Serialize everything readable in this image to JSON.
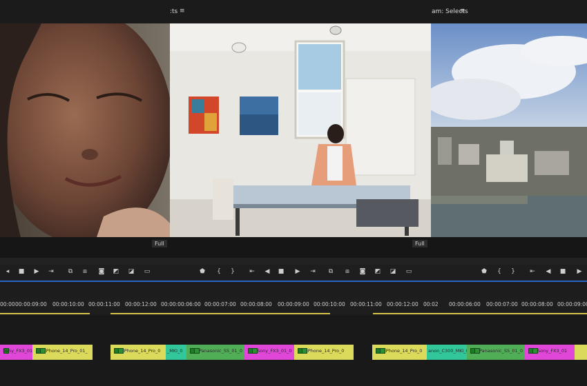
{
  "top": {
    "middle_title": ":ts",
    "right_title": "am: Selects",
    "menu_glyph": "≡"
  },
  "monitors": {
    "left_label": "Full",
    "right_label": "Full"
  },
  "left_transport": [
    "marker-icon",
    "go-in-icon",
    "step-back-icon",
    "play-icon",
    "step-forward-icon",
    "go-out-icon",
    "insert-icon",
    "overwrite-icon",
    "export-frame-icon",
    "lift-icon",
    "extract-icon",
    "settings-icon"
  ],
  "right_transport": [
    "marker-icon",
    "mark-in-icon",
    "mark-out-icon",
    "go-in-icon",
    "step-back-icon",
    "play-icon",
    "step-forward-icon",
    "go-out-icon",
    "insert-icon",
    "overwrite-icon",
    "export-frame-icon",
    "lift-icon",
    "extract-icon",
    "settings-icon"
  ],
  "timecodes": {
    "t1": "00:00",
    "t2": "00:00:09:00",
    "t3": "00:00:10:00",
    "t4": "00:00:11:00",
    "t5": "00:00:12:00",
    "t6": "00:00:00:06:00",
    "t7": "00:00:07:00",
    "t8": "00:00:08:00",
    "t9": "00:00:09:00",
    "t10": "00:00:10:00",
    "t11": "00:00:11:00",
    "t12": "00:00:12:00",
    "t13": "00:02",
    "t14": "00:00:06:00",
    "t15": "00:00:07:00",
    "t16": "00:00:08:00",
    "t17": "00:00:09:00"
  },
  "clips": {
    "c1": "Sony_FX3_01_",
    "c2": "iPhone_14_Pro_01_",
    "c3": "iPhone_14_Pro_0",
    "c4": "_MKI_0",
    "c5": "Panasonic_S5_01_0",
    "c6": "Sony_FX3_01_0",
    "c7": "iPhone_14_Pro_0",
    "c8": "iPhone_14_Pro_0",
    "c9": "anon_C300_MKI_0",
    "c10": "Panasonic_S5_01_0",
    "c11": "Sony_FX3_01"
  },
  "colors": {
    "pink": "#e046d8",
    "yellow": "#dcda5a",
    "teal": "#31c79a",
    "green": "#4fae56",
    "accent_blue": "#2a67c9"
  }
}
